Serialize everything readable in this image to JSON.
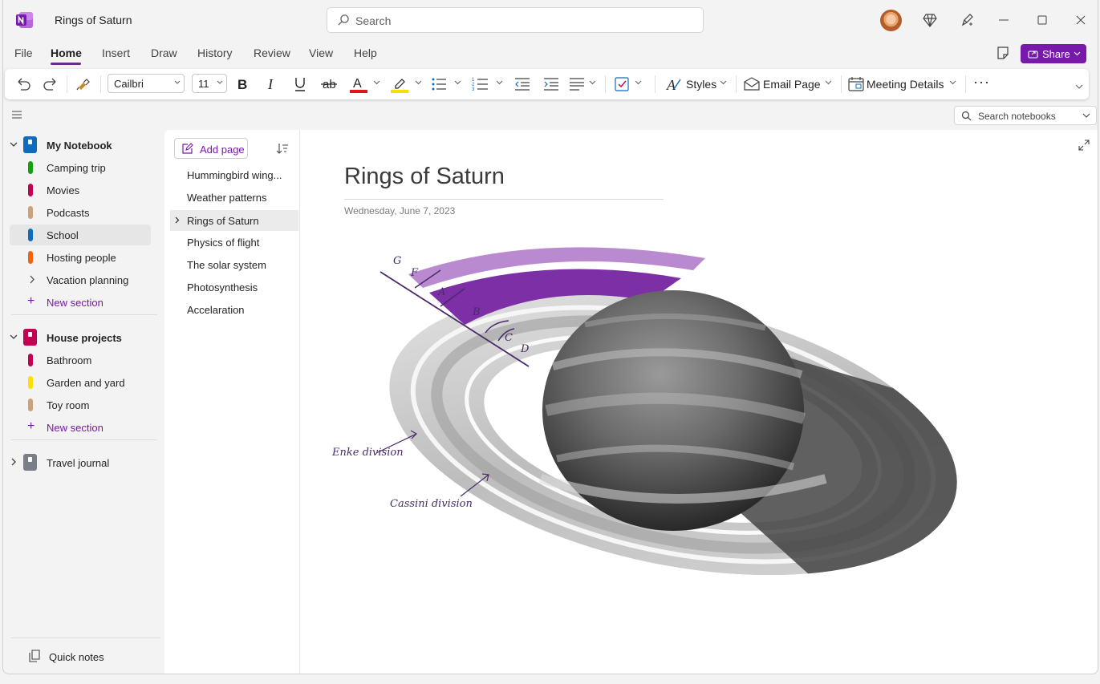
{
  "app": {
    "title": "Rings of Saturn",
    "search_placeholder": "Search"
  },
  "menu": {
    "tabs": [
      "File",
      "Home",
      "Insert",
      "Draw",
      "History",
      "Review",
      "View",
      "Help"
    ],
    "active": "Home",
    "share_label": "Share"
  },
  "ribbon": {
    "font_name": "Cailbri",
    "font_size": "11",
    "styles_label": "Styles",
    "email_label": "Email Page",
    "meeting_label": "Meeting Details",
    "more_label": "···"
  },
  "colors": {
    "accent": "#7719aa",
    "font_color": "#e0161b",
    "highlight": "#f4e100"
  },
  "search_notebooks": "Search notebooks",
  "notebooks": [
    {
      "name": "My Notebook",
      "color": "#0f6cbd",
      "expanded": true,
      "sections": [
        {
          "name": "Camping trip",
          "color": "#13a10e"
        },
        {
          "name": "Movies",
          "color": "#c30052"
        },
        {
          "name": "Podcasts",
          "color": "#c9a47a"
        },
        {
          "name": "School",
          "color": "#0f6cbd",
          "selected": true
        },
        {
          "name": "Hosting people",
          "color": "#f7630c"
        },
        {
          "name": "Vacation planning",
          "group": true
        }
      ],
      "new_section": "New section"
    },
    {
      "name": "House projects",
      "color": "#c30052",
      "expanded": true,
      "sections": [
        {
          "name": "Bathroom",
          "color": "#c30052"
        },
        {
          "name": "Garden and yard",
          "color": "#fce100"
        },
        {
          "name": "Toy room",
          "color": "#c9a47a"
        }
      ],
      "new_section": "New section"
    },
    {
      "name": "Travel journal",
      "color": "#7a7f87",
      "expanded": false
    }
  ],
  "quick_notes": "Quick notes",
  "pages": {
    "add_label": "Add page",
    "items": [
      "Hummingbird wing...",
      "Weather patterns",
      "Rings of Saturn",
      "Physics of flight",
      "The solar system",
      "Photosynthesis",
      "Accelaration"
    ],
    "active_index": 2
  },
  "page": {
    "title": "Rings of Saturn",
    "date": "Wednesday, June 7, 2023",
    "ring_labels": [
      "G",
      "F",
      "A",
      "B",
      "C",
      "D"
    ],
    "annotations": {
      "enke": "Enke division",
      "cassini": "Cassini division"
    }
  }
}
